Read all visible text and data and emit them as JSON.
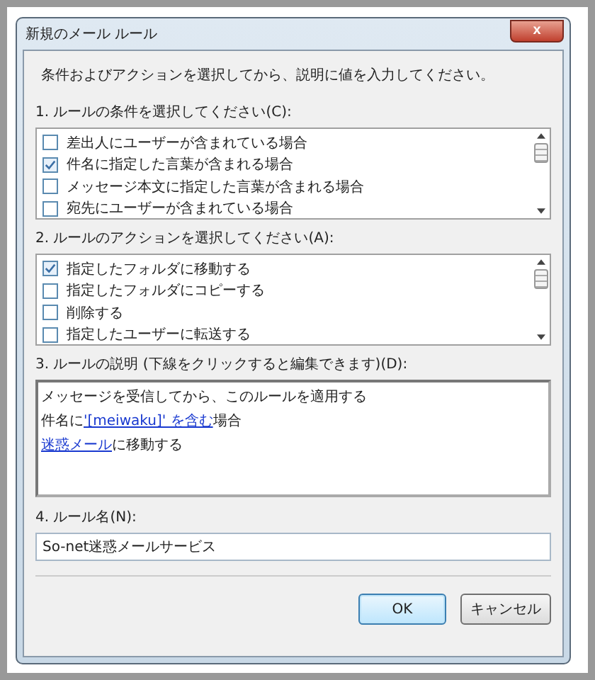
{
  "window": {
    "title": "新規のメール ルール",
    "close": "x"
  },
  "instruction": "条件およびアクションを選択してから、説明に値を入力してください。",
  "conditions": {
    "label": "1. ルールの条件を選択してください(C):",
    "items": [
      {
        "label": "差出人にユーザーが含まれている場合",
        "checked": false
      },
      {
        "label": "件名に指定した言葉が含まれる場合",
        "checked": true
      },
      {
        "label": "メッセージ本文に指定した言葉が含まれる場合",
        "checked": false
      },
      {
        "label": "宛先にユーザーが含まれている場合",
        "checked": false
      }
    ]
  },
  "actions": {
    "label": "2. ルールのアクションを選択してください(A):",
    "items": [
      {
        "label": "指定したフォルダに移動する",
        "checked": true
      },
      {
        "label": "指定したフォルダにコピーする",
        "checked": false
      },
      {
        "label": "削除する",
        "checked": false
      },
      {
        "label": "指定したユーザーに転送する",
        "checked": false
      }
    ]
  },
  "description": {
    "label": "3. ルールの説明 (下線をクリックすると編集できます)(D):",
    "lines": [
      [
        {
          "text": "メッセージを受信してから、このルールを適用する",
          "link": false
        }
      ],
      [
        {
          "text": "件名に",
          "link": false
        },
        {
          "text": "'[meiwaku]' を含む",
          "link": true
        },
        {
          "text": "場合",
          "link": false
        }
      ],
      [
        {
          "text": "迷惑メール",
          "link": true
        },
        {
          "text": "に移動する",
          "link": false
        }
      ]
    ]
  },
  "rule_name": {
    "label": "4. ルール名(N):",
    "value": "So-net迷惑メールサービス"
  },
  "buttons": [
    {
      "label": "OK",
      "default": true
    },
    {
      "label": "キャンセル",
      "default": false
    }
  ]
}
